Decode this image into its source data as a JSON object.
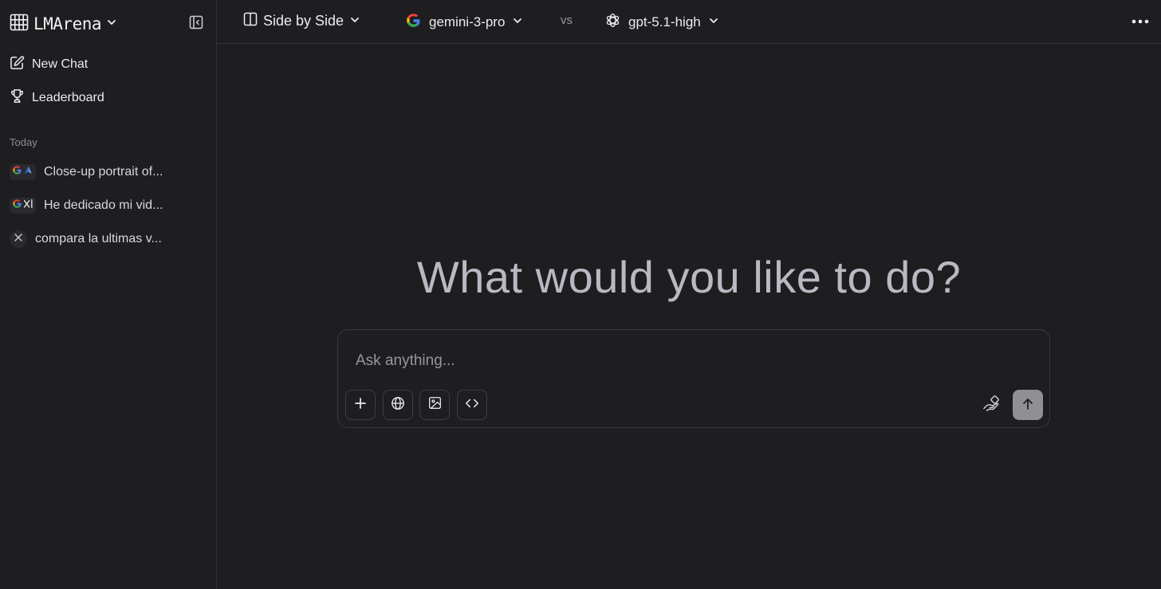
{
  "sidebar": {
    "brand": "LMArena",
    "nav": [
      {
        "label": "New Chat",
        "icon": "edit-icon"
      },
      {
        "label": "Leaderboard",
        "icon": "trophy-icon"
      }
    ],
    "section_label": "Today",
    "history": [
      {
        "label": "Close-up portrait of...",
        "icons": [
          "google-g-icon",
          "sail-logo-icon"
        ]
      },
      {
        "label": "He dedicado mi vid...",
        "icons": [
          "google-g-icon",
          "xai-logo-icon"
        ]
      },
      {
        "label": "compara la ultimas v...",
        "icons": [
          "xai-x-icon"
        ]
      }
    ]
  },
  "topbar": {
    "mode_label": "Side by Side",
    "model_a": "gemini-3-pro",
    "vs_label": "vs",
    "model_b": "gpt-5.1-high"
  },
  "main": {
    "headline": "What would you like to do?",
    "input_placeholder": "Ask anything..."
  },
  "colors": {
    "background": "#1e1e21",
    "border": "#333338",
    "send_button": "#8f8f94",
    "headline": "#b9b9c3"
  }
}
